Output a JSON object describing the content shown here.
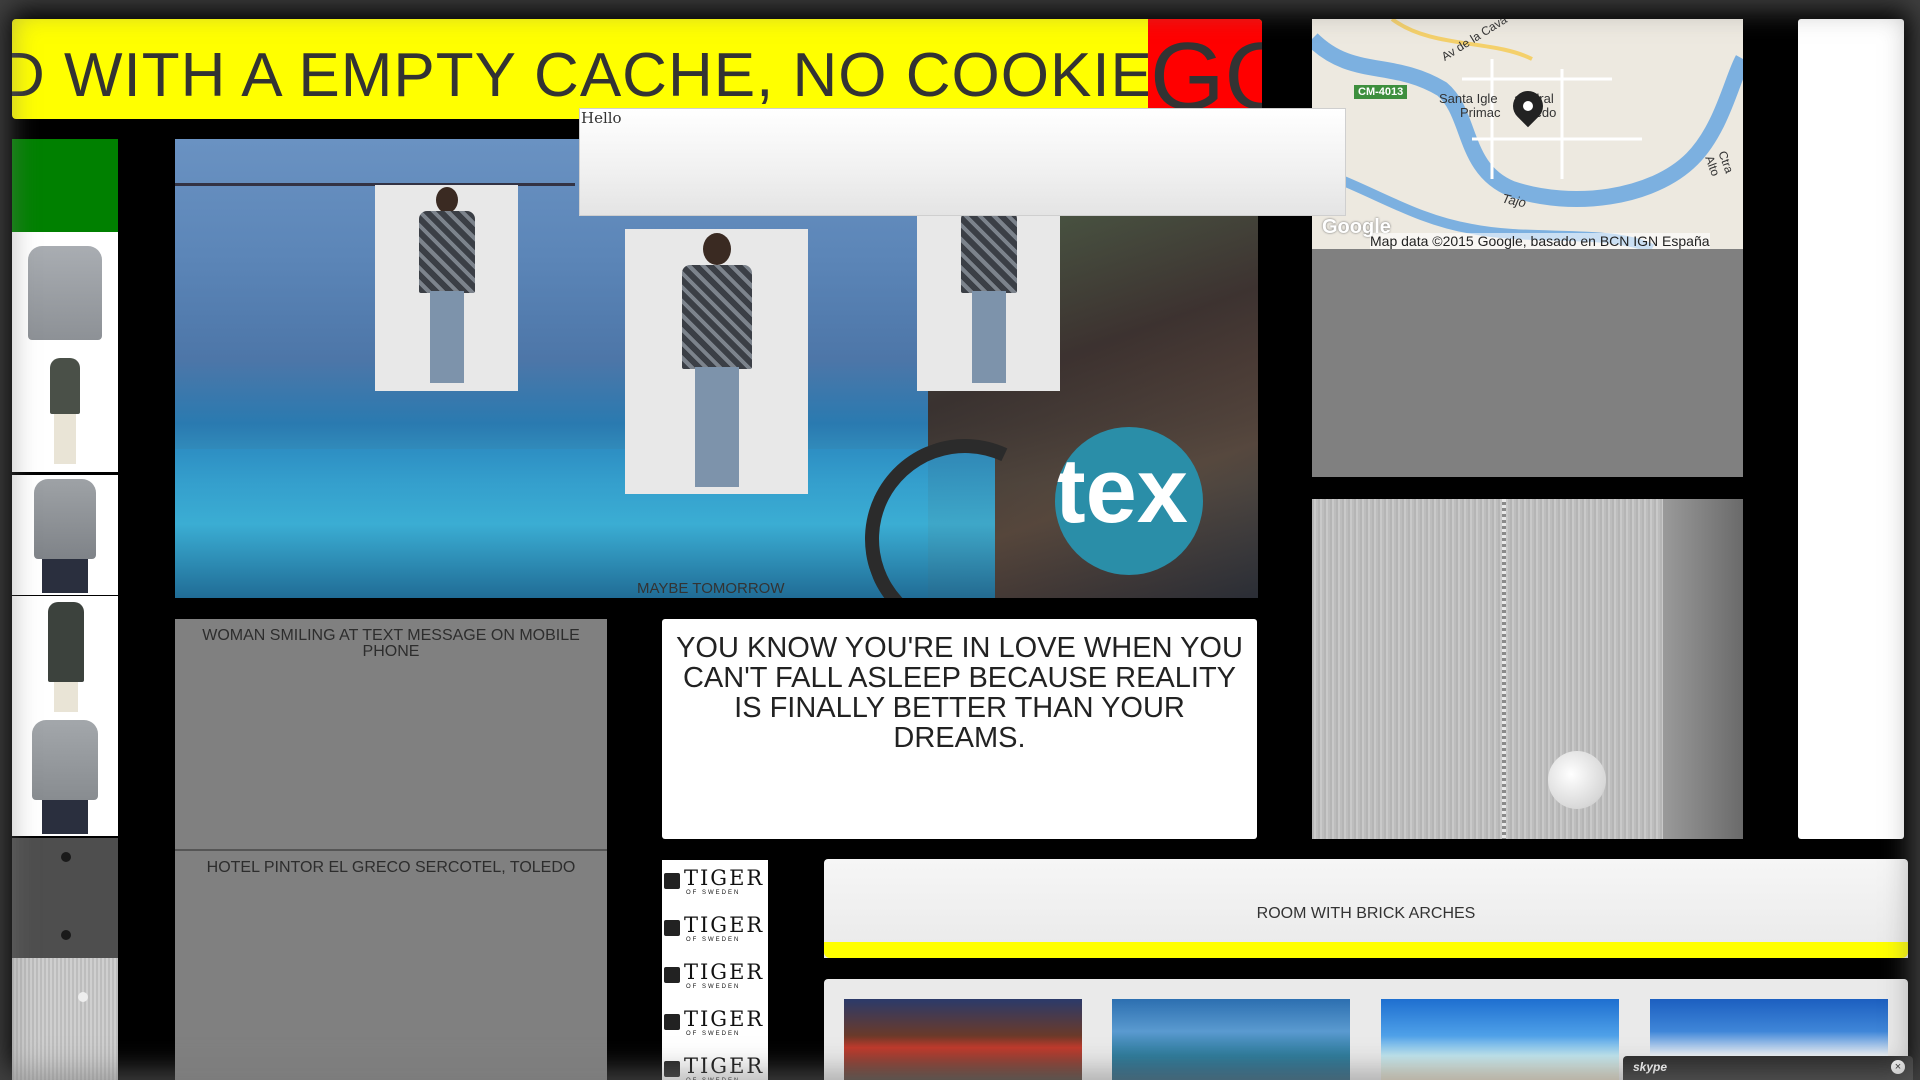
{
  "ticker": {
    "text": "D WITH A EMPTY CACHE, NO COOKIES A",
    "overflow_text": "GO",
    "bg": "#ffff00",
    "accent": "#ff0000"
  },
  "popup": {
    "text": "Hello"
  },
  "hero": {
    "caption": "MAYBE TOMORROW",
    "badge_text": "tex",
    "badge_color": "#2a8ea8"
  },
  "map": {
    "road_badge": "CM-4013",
    "label_1": "Santa Igle",
    "label_2": "Primac",
    "label_3": "atedral",
    "label_4": "Toledo",
    "street_1": "Av de la Cava",
    "street_2": "Ctra Alto",
    "river": "Tajo",
    "logo": "Google",
    "attribution": "Map data ©2015 Google, basado en BCN IGN España"
  },
  "panels": {
    "woman": "WOMAN SMILING AT TEXT MESSAGE ON MOBILE PHONE",
    "hotel": "HOTEL PINTOR EL GRECO SERCOTEL, TOLEDO"
  },
  "quote": {
    "text": "YOU KNOW YOU'RE IN LOVE WHEN YOU CAN'T FALL ASLEEP BECAUSE REALITY IS FINALLY BETTER THAN YOUR DREAMS."
  },
  "tiger": {
    "word": "TIGER",
    "sub": "OF SWEDEN"
  },
  "room": {
    "caption": "ROOM WITH BRICK ARCHES"
  },
  "skype": {
    "label": "skype",
    "close": "×"
  }
}
